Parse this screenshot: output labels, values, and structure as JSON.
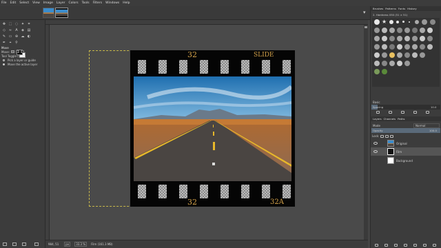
{
  "menu": [
    "File",
    "Edit",
    "Select",
    "View",
    "Image",
    "Layer",
    "Colors",
    "Tools",
    "Filters",
    "Windows",
    "Help"
  ],
  "tool_options": {
    "title": "Move",
    "move_label": "Move:",
    "toggle_label": "Tool Toggle  (Shift)",
    "option1": "Pick a layer or guide",
    "option2": "Move the active layer"
  },
  "film": {
    "top_left": "32",
    "top_right": "SLIDE",
    "bottom_left": "32",
    "bottom_right": "32A"
  },
  "status": {
    "coords": "984, 51",
    "unit": "px",
    "zoom": "33.3 %",
    "layer_info": "Film (161.3 MB)"
  },
  "dock_top": {
    "tabs": [
      "Brushes",
      "Patterns",
      "Fonts",
      "History"
    ],
    "brush_name": "2. Hardness 050 (51 × 51)",
    "filter_label": "Basic",
    "spacing_label": "Spacing",
    "spacing_value": "10.0"
  },
  "dock_layers": {
    "tabs": [
      "Layers",
      "Channels",
      "Paths"
    ],
    "mode_label": "Mode",
    "mode_value": "Normal",
    "opacity_label": "Opacity",
    "opacity_value": "100.0",
    "lock_label": "Lock:",
    "layers": [
      {
        "name": "Original",
        "visible": true
      },
      {
        "name": "Film",
        "visible": true
      },
      {
        "name": "Background",
        "visible": false
      }
    ]
  },
  "colors": {
    "film_text": "#d4a24a",
    "selection": "#c8b84a",
    "sky": "#2a82c0",
    "road": "#4a4542",
    "line": "#e8b82a"
  }
}
